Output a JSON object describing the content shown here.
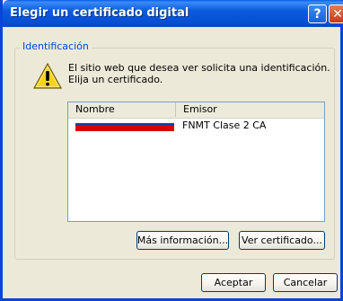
{
  "window": {
    "title": "Elegir un certificado digital",
    "help_button": "?",
    "close_button": "✕"
  },
  "group": {
    "legend": "Identificación",
    "message_line1": "El sitio web que desea ver solicita una identificación.",
    "message_line2": "Elija un certificado.",
    "warning_icon": "warning-icon"
  },
  "list": {
    "columns": [
      "Nombre",
      "Emisor"
    ],
    "rows": [
      {
        "name": "[redacted]",
        "issuer": "FNMT Clase 2 CA"
      }
    ]
  },
  "buttons": {
    "more_info": "Más información...",
    "view_cert": "Ver certificado...",
    "accept": "Aceptar",
    "cancel": "Cancelar"
  },
  "colors": {
    "titlebar": "#0b5bdf",
    "legend": "#0046d5",
    "redaction_red": "#e00000",
    "redaction_blue": "#1a3fa0"
  }
}
